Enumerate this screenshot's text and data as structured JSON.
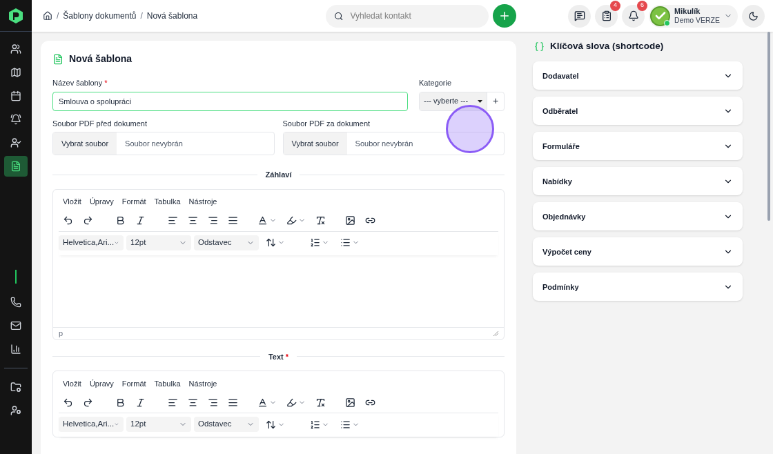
{
  "sidebar": {
    "items": [
      {
        "selected": false
      },
      {
        "selected": false
      },
      {
        "selected": false
      },
      {
        "selected": false
      },
      {
        "selected": false
      },
      {
        "selected": true
      }
    ]
  },
  "breadcrumb": [
    {
      "separator": "/",
      "label": "Šablony dokumentů"
    },
    {
      "separator": "/",
      "label": "Nová šablona"
    }
  ],
  "search": {
    "placeholder": "Vyhledat kontakt"
  },
  "header_badges": [
    "4",
    "6"
  ],
  "user": {
    "name": "Mikulík",
    "subtitle": "Demo VERZE",
    "online": true
  },
  "form": {
    "title": "Nová šablona",
    "name_field": {
      "label": "Název šablony",
      "required_mark": "*",
      "value": "Smlouva o spolupráci"
    },
    "category": {
      "label": "Kategorie",
      "value": "--- vyberte ---",
      "add": "+"
    },
    "files": [
      {
        "label": "Soubor PDF před dokument",
        "button": "Vybrat soubor",
        "status": "Soubor nevybrán"
      },
      {
        "label": "Soubor PDF za dokument",
        "button": "Vybrat soubor",
        "status": "Soubor nevybrán"
      }
    ],
    "editors": [
      {
        "heading": "Záhlaví",
        "menu": [
          "Vložit",
          "Úpravy",
          "Formát",
          "Tabulka",
          "Nástroje"
        ],
        "font": "Helvetica,Ari...",
        "size": "12pt",
        "block": "Odstavec",
        "path": "p"
      },
      {
        "heading": "Text",
        "required_mark": "*",
        "menu": [
          "Vložit",
          "Úpravy",
          "Formát",
          "Tabulka",
          "Nástroje"
        ],
        "font": "Helvetica,Ari...",
        "size": "12pt",
        "block": "Odstavec"
      }
    ]
  },
  "shortcodes": {
    "title": "Klíčová slova (shortcode)",
    "groups": [
      {
        "label": "Dodavatel",
        "expanded": false
      },
      {
        "label": "Odběratel",
        "expanded": false
      },
      {
        "label": "Formuláře",
        "expanded": false
      },
      {
        "label": "Nabídky",
        "expanded": false
      },
      {
        "label": "Objednávky",
        "expanded": false
      },
      {
        "label": "Výpočet ceny",
        "expanded": false
      },
      {
        "label": "Podmínky",
        "expanded": false
      }
    ]
  }
}
